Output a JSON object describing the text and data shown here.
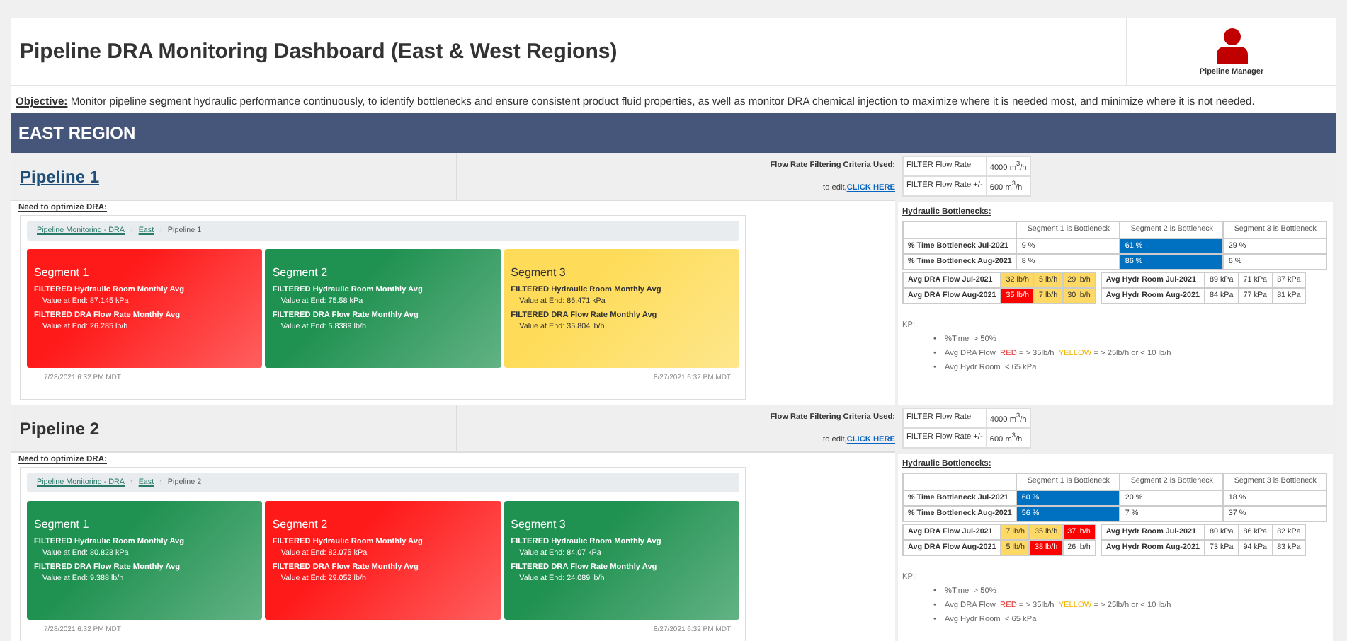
{
  "header": {
    "title": "Pipeline DRA Monitoring Dashboard (East & West Regions)",
    "user_label": "Pipeline Manager"
  },
  "objective": {
    "label": "Objective:",
    "text": " Monitor pipeline segment hydraulic performance continuously, to identify bottlenecks and ensure consistent product fluid properties, as well as monitor DRA chemical injection to maximize where it is needed most, and minimize where it is not needed."
  },
  "region": {
    "title": "EAST REGION"
  },
  "pipelines": [
    {
      "title": "Pipeline 1",
      "title_link": true,
      "criteria_label": "Flow Rate Filtering Criteria Used:",
      "edit_prefix": "to edit, ",
      "edit_link": "CLICK HERE",
      "filters": [
        {
          "label": "FILTER Flow Rate",
          "value": "4000 m$^{3}$/h"
        },
        {
          "label": "FILTER Flow Rate +/-",
          "value": "600 m$^{3}$/h"
        }
      ],
      "need_label": "Need to optimize DRA:",
      "breadcrumb_separator": "›",
      "breadcrumb": [
        {
          "text": "Pipeline Monitoring - DRA",
          "link": true
        },
        {
          "text": "East",
          "link": true
        },
        {
          "text": "Pipeline 1",
          "link": false
        }
      ],
      "segments": [
        {
          "title": "Segment 1",
          "color": "#ff1a1a",
          "metrics": [
            {
              "label": "FILTERED Hydraulic Room Monthly Avg",
              "value": "Value at End: 87.145 kPa"
            },
            {
              "label": "FILTERED DRA Flow Rate Monthly Avg",
              "value": "Value at End: 26.285 lb/h"
            }
          ]
        },
        {
          "title": "Segment 2",
          "color": "#1f9150",
          "metrics": [
            {
              "label": "FILTERED Hydraulic Room Monthly Avg",
              "value": "Value at End: 75.58 kPa"
            },
            {
              "label": "FILTERED DRA Flow Rate Monthly Avg",
              "value": "Value at End: 5.8389 lb/h"
            }
          ]
        },
        {
          "title": "Segment 3",
          "color": "#fedc5a",
          "metrics": [
            {
              "label": "FILTERED Hydraulic Room Monthly Avg",
              "value": "Value at End: 86.471 kPa"
            },
            {
              "label": "FILTERED DRA Flow Rate Monthly Avg",
              "value": "Value at End: 35.804 lb/h"
            }
          ]
        }
      ],
      "date_start": "7/28/2021 6:32 PM  MDT",
      "date_end": "8/27/2021 6:32 PM  MDT",
      "bottleneck_heading": "Hydraulic Bottlenecks:",
      "bottleneck_columns": [
        "Segment 1 is Bottleneck",
        "Segment 2 is Bottleneck",
        "Segment 3 is Bottleneck"
      ],
      "bottleneck_rows": [
        {
          "label": "% Time Bottleneck Jul-2021",
          "cells": [
            {
              "text": "9 %",
              "highlight": false
            },
            {
              "text": "61 %",
              "highlight": true
            },
            {
              "text": "29 %",
              "highlight": false
            }
          ]
        },
        {
          "label": "% Time Bottleneck Aug-2021",
          "cells": [
            {
              "text": "8 %",
              "highlight": false
            },
            {
              "text": "86 %",
              "highlight": true
            },
            {
              "text": "6 %",
              "highlight": false
            }
          ]
        }
      ],
      "dra_rows": [
        {
          "label": "Avg DRA Flow Jul-2021",
          "cells": [
            {
              "text": "32 lb/h",
              "color": "#ffd966"
            },
            {
              "text": "5 lb/h",
              "color": "#ffd966"
            },
            {
              "text": "29 lb/h",
              "color": "#ffd966"
            }
          ]
        },
        {
          "label": "Avg DRA Flow Aug-2021",
          "cells": [
            {
              "text": "35 lb/h",
              "color": "#ff0000"
            },
            {
              "text": "7 lb/h",
              "color": "#ffd966"
            },
            {
              "text": "30 lb/h",
              "color": "#ffd966"
            }
          ]
        }
      ],
      "hydr_rows": [
        {
          "label": "Avg Hydr Room Jul-2021",
          "cells": [
            "89 kPa",
            "71 kPa",
            "87 kPa"
          ]
        },
        {
          "label": "Avg Hydr Room Aug-2021",
          "cells": [
            "84 kPa",
            "77 kPa",
            "81 kPa"
          ]
        }
      ],
      "kpi_label": "KPI:",
      "kpi_bullet": "•",
      "kpi_items": [
        [
          {
            "text": "%Time  > 50%"
          }
        ],
        [
          {
            "text": "Avg DRA Flow  "
          },
          {
            "text": "RED",
            "color": "#e03030"
          },
          {
            "text": " = > 35lb/h  "
          },
          {
            "text": "YELLOW",
            "color": "#f0b400"
          },
          {
            "text": " = > 25lb/h or < 10 lb/h"
          }
        ],
        [
          {
            "text": "Avg Hydr Room  < 65 kPa"
          }
        ]
      ]
    },
    {
      "title": "Pipeline 2",
      "title_link": false,
      "criteria_label": "Flow Rate Filtering Criteria Used:",
      "edit_prefix": "to edit, ",
      "edit_link": "CLICK HERE",
      "filters": [
        {
          "label": "FILTER Flow Rate",
          "value": "4000 m$^{3}$/h"
        },
        {
          "label": "FILTER Flow Rate +/-",
          "value": "600 m$^{3}$/h"
        }
      ],
      "need_label": "Need to optimize DRA:",
      "breadcrumb_separator": "›",
      "breadcrumb": [
        {
          "text": "Pipeline Monitoring - DRA",
          "link": true
        },
        {
          "text": "East",
          "link": true
        },
        {
          "text": "Pipeline 2",
          "link": false
        }
      ],
      "segments": [
        {
          "title": "Segment 1",
          "color": "#1f9150",
          "metrics": [
            {
              "label": "FILTERED Hydraulic Room Monthly Avg",
              "value": "Value at End: 80.823 kPa"
            },
            {
              "label": "FILTERED DRA Flow Rate Monthly Avg",
              "value": "Value at End: 9.388 lb/h"
            }
          ]
        },
        {
          "title": "Segment 2",
          "color": "#ff1a1a",
          "metrics": [
            {
              "label": "FILTERED Hydraulic Room Monthly Avg",
              "value": "Value at End: 82.075 kPa"
            },
            {
              "label": "FILTERED DRA Flow Rate Monthly Avg",
              "value": "Value at End: 29.052 lb/h"
            }
          ]
        },
        {
          "title": "Segment 3",
          "color": "#1f9150",
          "metrics": [
            {
              "label": "FILTERED Hydraulic Room Monthly Avg",
              "value": "Value at End: 84.07 kPa"
            },
            {
              "label": "FILTERED DRA Flow Rate Monthly Avg",
              "value": "Value at End: 24.089 lb/h"
            }
          ]
        }
      ],
      "date_start": "7/28/2021 6:32 PM  MDT",
      "date_end": "8/27/2021 6:32 PM  MDT",
      "bottleneck_heading": "Hydraulic Bottlenecks:",
      "bottleneck_columns": [
        "Segment 1 is Bottleneck",
        "Segment 2 is Bottleneck",
        "Segment 3 is Bottleneck"
      ],
      "bottleneck_rows": [
        {
          "label": "% Time Bottleneck Jul-2021",
          "cells": [
            {
              "text": "60 %",
              "highlight": true
            },
            {
              "text": "20 %",
              "highlight": false
            },
            {
              "text": "18 %",
              "highlight": false
            }
          ]
        },
        {
          "label": "% Time Bottleneck Aug-2021",
          "cells": [
            {
              "text": "56 %",
              "highlight": true
            },
            {
              "text": "7 %",
              "highlight": false
            },
            {
              "text": "37 %",
              "highlight": false
            }
          ]
        }
      ],
      "dra_rows": [
        {
          "label": "Avg DRA Flow Jul-2021",
          "cells": [
            {
              "text": "7 lb/h",
              "color": "#ffd966"
            },
            {
              "text": "35 lb/h",
              "color": "#ffd966"
            },
            {
              "text": "37 lb/h",
              "color": "#ff0000"
            }
          ]
        },
        {
          "label": "Avg DRA Flow Aug-2021",
          "cells": [
            {
              "text": "5 lb/h",
              "color": "#ffd966"
            },
            {
              "text": "38 lb/h",
              "color": "#ff0000"
            },
            {
              "text": "26 lb/h",
              "color": "#ffffff"
            }
          ]
        }
      ],
      "hydr_rows": [
        {
          "label": "Avg Hydr Room Jul-2021",
          "cells": [
            "80 kPa",
            "86 kPa",
            "82 kPa"
          ]
        },
        {
          "label": "Avg Hydr Room Aug-2021",
          "cells": [
            "73 kPa",
            "94 kPa",
            "83 kPa"
          ]
        }
      ],
      "kpi_label": "KPI:",
      "kpi_bullet": "•",
      "kpi_items": [
        [
          {
            "text": "%Time  > 50%"
          }
        ],
        [
          {
            "text": "Avg DRA Flow  "
          },
          {
            "text": "RED",
            "color": "#e03030"
          },
          {
            "text": " = > 35lb/h  "
          },
          {
            "text": "YELLOW",
            "color": "#f0b400"
          },
          {
            "text": " = > 25lb/h or < 10 lb/h"
          }
        ],
        [
          {
            "text": "Avg Hydr Room  < 65 kPa"
          }
        ]
      ]
    }
  ]
}
